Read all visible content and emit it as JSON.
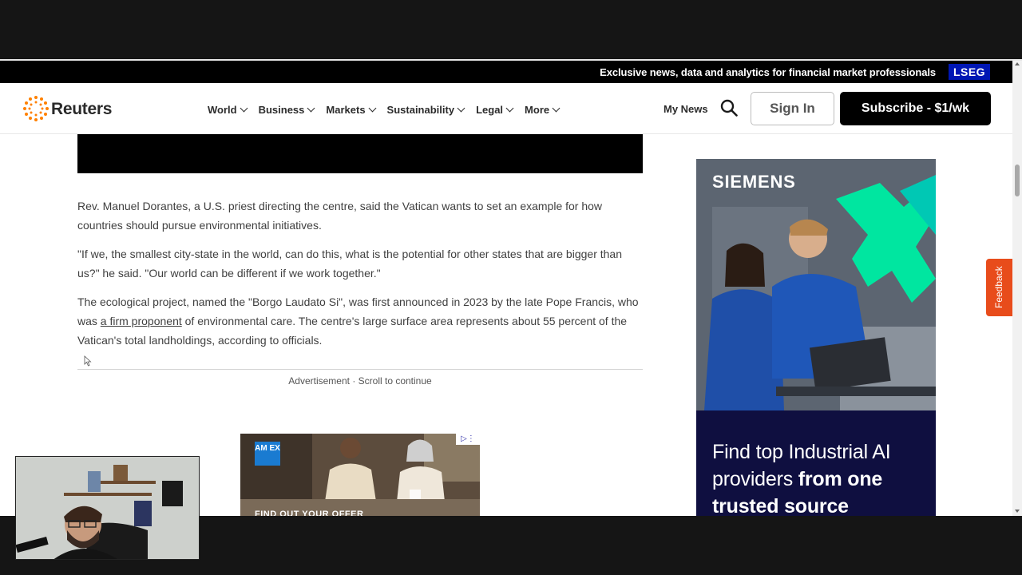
{
  "promo": {
    "text": "Exclusive news, data and analytics for financial market professionals",
    "badge": "LSEG"
  },
  "header": {
    "logo_text": "Reuters",
    "nav": [
      "World",
      "Business",
      "Markets",
      "Sustainability",
      "Legal",
      "More"
    ],
    "my_news": "My News",
    "sign_in": "Sign In",
    "subscribe": "Subscribe - $1/wk"
  },
  "article": {
    "p1": "Rev. Manuel Dorantes, a U.S. priest directing the centre, said the Vatican wants to set an example for how countries should pursue environmental initiatives.",
    "p2": "\"If we, the smallest city-state in the world, can do this, what is the potential for other states that are bigger than us?\" he said. \"Our world can be different if we work together.\"",
    "p3_before": "The ecological project, named the \"Borgo Laudato Si\", was first announced in 2023 by the late Pope Francis, who was ",
    "p3_link": "a firm proponent",
    "p3_after": " of environmental care. The centre's large surface area represents about 55 percent of the Vatican's total landholdings, according to officials.",
    "ad_label": "Advertisement · Scroll to continue"
  },
  "inline_ad": {
    "brand": "AM EX",
    "cta": "FIND OUT YOUR OFFER"
  },
  "side_ad": {
    "brand": "SIEMENS",
    "line1": "Find top Industrial AI",
    "line2a": "providers ",
    "line2b": "from one",
    "line3": "trusted source"
  },
  "feedback": "Feedback",
  "colors": {
    "reuters_orange": "#ff8000",
    "lseg_blue": "#0016b4",
    "feedback_orange": "#e84c1b",
    "siemens_green": "#00e6a0",
    "siemens_navy": "#0f0f40"
  }
}
